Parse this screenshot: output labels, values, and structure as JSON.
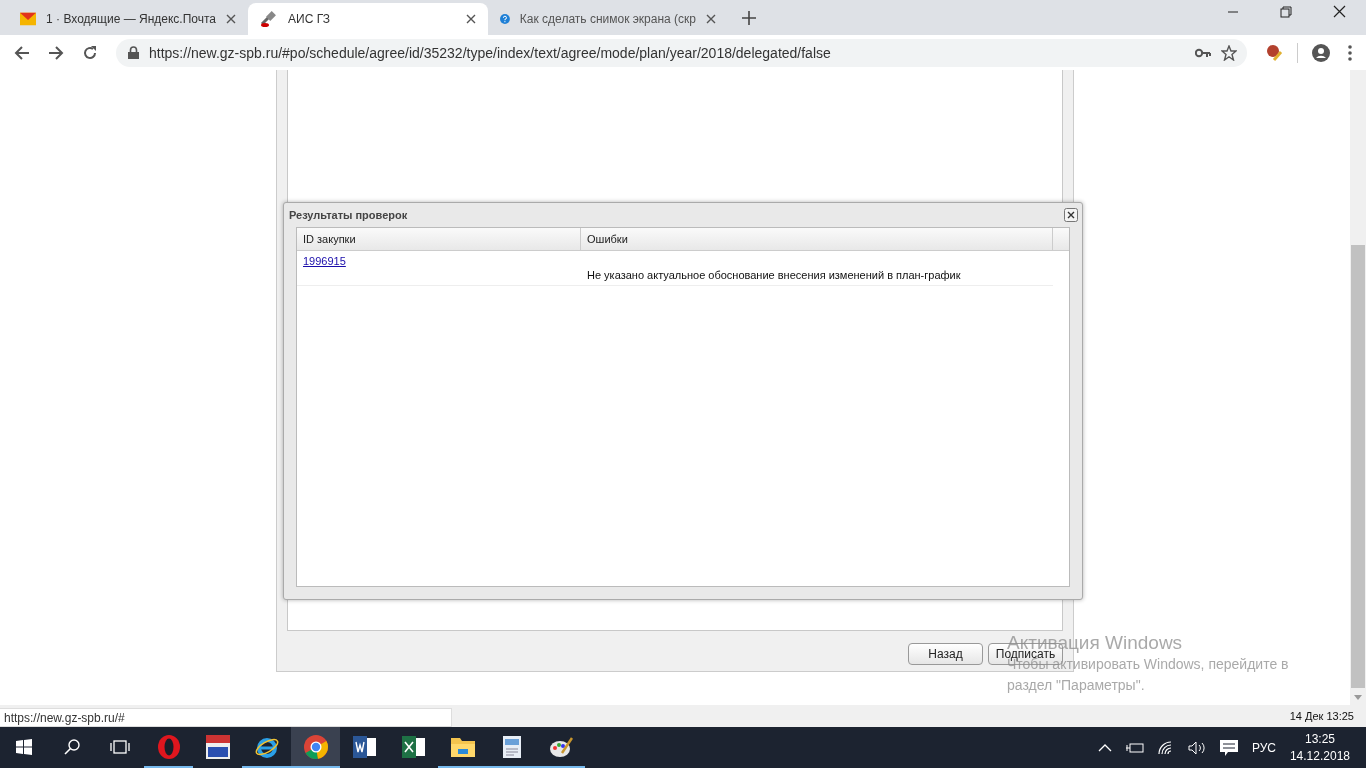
{
  "browser": {
    "tabs": [
      {
        "title": "1 · Входящие — Яндекс.Почта",
        "kind": "mail",
        "selected": false
      },
      {
        "title": "АИС ГЗ",
        "kind": "gavel",
        "selected": true
      },
      {
        "title": "Как сделать снимок экрана (скр",
        "kind": "help",
        "selected": false
      }
    ],
    "url": "https://new.gz-spb.ru/#po/schedule/agree/id/35232/type/index/text/agree/mode/plan/year/2018/delegated/false"
  },
  "page": {
    "buttons": [
      "Назад",
      "Подписать"
    ],
    "status_url": "https://new.gz-spb.ru/#",
    "clock": "14 Дек 13:25"
  },
  "dialog": {
    "title": "Результаты проверок",
    "columns": [
      "ID закупки",
      "Ошибки"
    ],
    "rows": [
      {
        "id": "1996915",
        "error": "Не указано актуальное обоснование внесения изменений в план-график"
      }
    ]
  },
  "activation": {
    "title": "Активация Windows",
    "lines": [
      "Чтобы активировать Windows, перейдите в",
      "раздел \"Параметры\"."
    ]
  },
  "taskbar": {
    "apps": [
      {
        "kind": "opera",
        "running": true,
        "selected": false
      },
      {
        "kind": "pdf",
        "running": false,
        "selected": false
      },
      {
        "kind": "ie",
        "running": true,
        "selected": false
      },
      {
        "kind": "chrome",
        "running": true,
        "selected": true
      },
      {
        "kind": "word",
        "running": false,
        "selected": false
      },
      {
        "kind": "excel",
        "running": false,
        "selected": false
      },
      {
        "kind": "folder",
        "running": true,
        "selected": false
      },
      {
        "kind": "wordpad",
        "running": true,
        "selected": false
      },
      {
        "kind": "paint",
        "running": true,
        "selected": false
      }
    ],
    "language": "РУС",
    "time": "13:25",
    "date": "14.12.2018"
  }
}
